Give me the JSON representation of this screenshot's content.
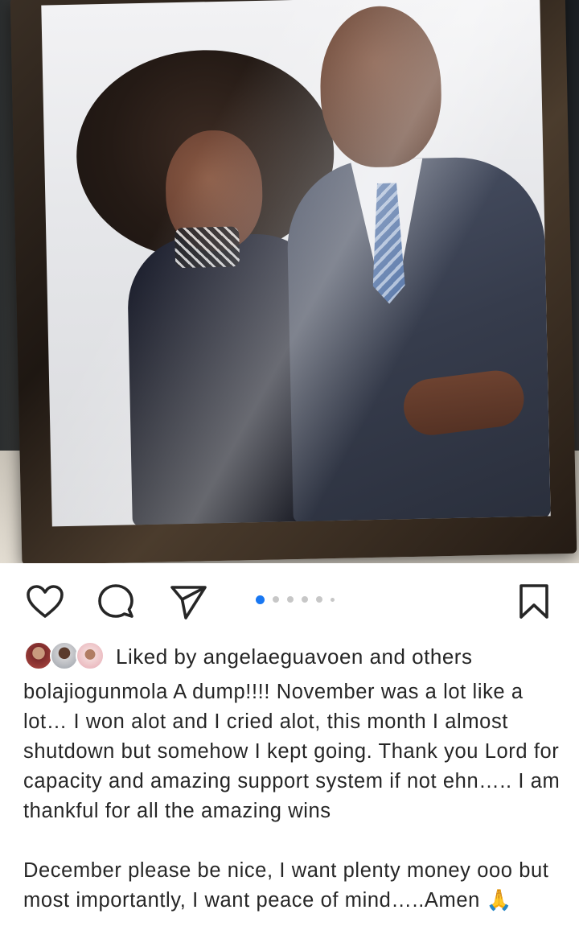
{
  "post": {
    "username": "bolajiogunmola",
    "caption_lines": [
      " A dump!!!! November was a lot like a lot… I won alot and I cried alot, this month I almost shutdown but somehow I kept going. Thank you Lord for capacity and amazing support system if not ehn….. I am thankful for all the amazing wins",
      " December please be nice, I want plenty money ooo but most importantly, I want peace of mind…..Amen 🙏"
    ]
  },
  "likes": {
    "text": "Liked by angelaeguavoen and others"
  },
  "carousel": {
    "current_index": 1,
    "total_dots": 6
  },
  "icons": {
    "like": "heart-icon",
    "comment": "comment-icon",
    "share": "paper-plane-icon",
    "save": "bookmark-icon"
  },
  "colors": {
    "accent": "#1877f2",
    "text": "#262626",
    "inactive_dot": "#c7c7c7"
  }
}
